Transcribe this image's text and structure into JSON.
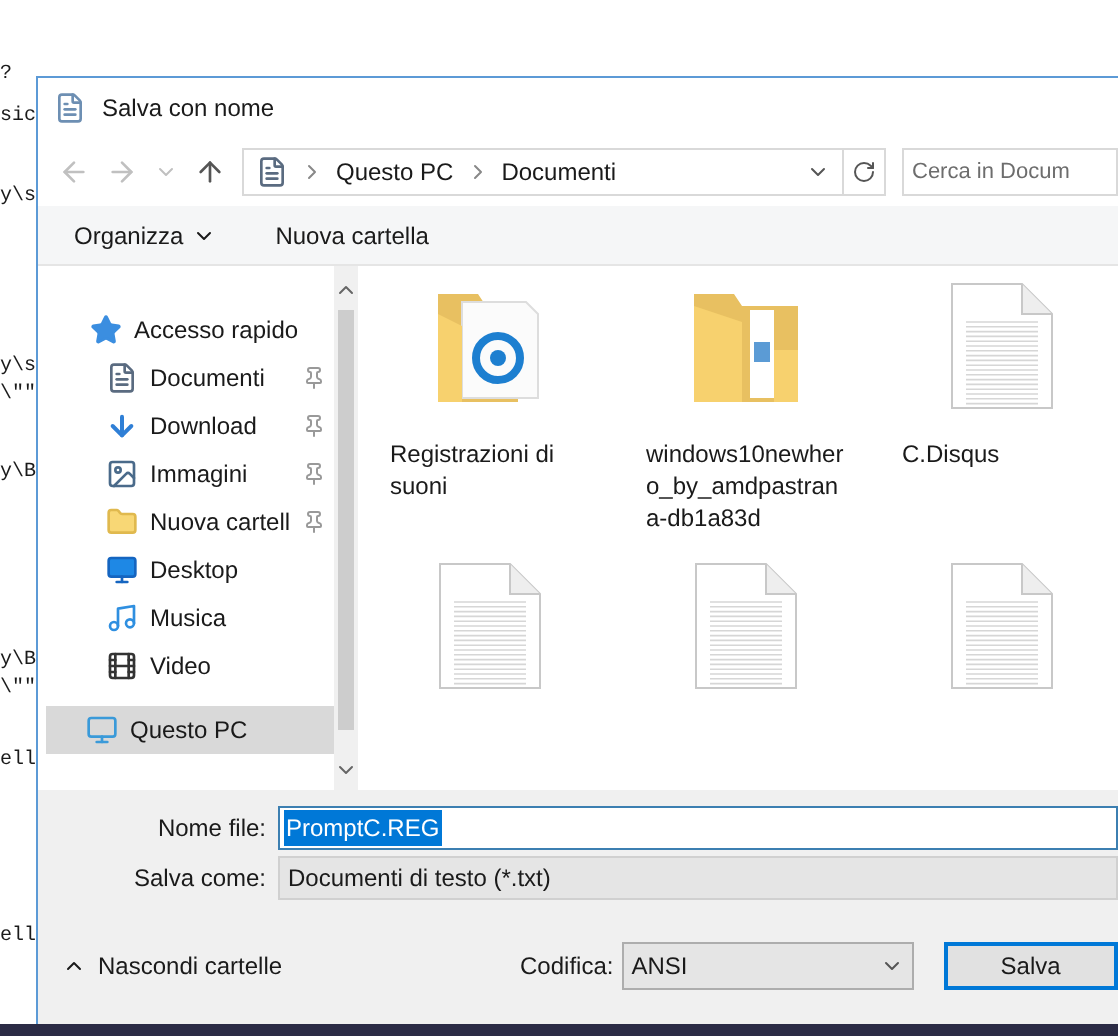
{
  "notepad": {
    "lines": [
      "?",
      "sic",
      "y\\s",
      "y\\s",
      "\\\"\"",
      "y\\B",
      "y\\B",
      "\\\"\"",
      "ell",
      "ell"
    ]
  },
  "dialog": {
    "title": "Salva con nome",
    "nav": {
      "breadcrumb": [
        "Questo PC",
        "Documenti"
      ],
      "search": {
        "placeholder": "Cerca in Docum"
      }
    },
    "toolbar": {
      "organize": "Organizza",
      "new_folder": "Nuova cartella"
    },
    "sidebar": {
      "items": [
        {
          "label": "Accesso rapido",
          "kind": "star",
          "pinned": false,
          "selected": false
        },
        {
          "label": "Documenti",
          "kind": "document",
          "pinned": true,
          "selected": false
        },
        {
          "label": "Download",
          "kind": "download",
          "pinned": true,
          "selected": false
        },
        {
          "label": "Immagini",
          "kind": "image",
          "pinned": true,
          "selected": false
        },
        {
          "label": "Nuova cartell",
          "kind": "folder",
          "pinned": true,
          "selected": false
        },
        {
          "label": "Desktop",
          "kind": "desktop",
          "pinned": false,
          "selected": false
        },
        {
          "label": "Musica",
          "kind": "music",
          "pinned": false,
          "selected": false
        },
        {
          "label": "Video",
          "kind": "video",
          "pinned": false,
          "selected": false
        },
        {
          "label": "Questo PC",
          "kind": "computer",
          "pinned": false,
          "selected": true
        }
      ]
    },
    "files": [
      {
        "name": "Registrazioni di suoni",
        "kind": "audio-folder"
      },
      {
        "name": "windows10newhero_by_amdpastrana-db1a83d",
        "kind": "picture-folder"
      },
      {
        "name": "C.Disqus",
        "kind": "text"
      },
      {
        "kind": "text"
      },
      {
        "kind": "text"
      },
      {
        "kind": "text"
      }
    ],
    "form": {
      "filename_label": "Nome file:",
      "filename": "PromptC.REG",
      "filename_selected": true,
      "type_label": "Salva come:",
      "type": "Documenti di testo (*.txt)",
      "hide_folders": "Nascondi cartelle",
      "encoding_label": "Codifica:",
      "encoding": "ANSI",
      "save": "Salva"
    }
  }
}
